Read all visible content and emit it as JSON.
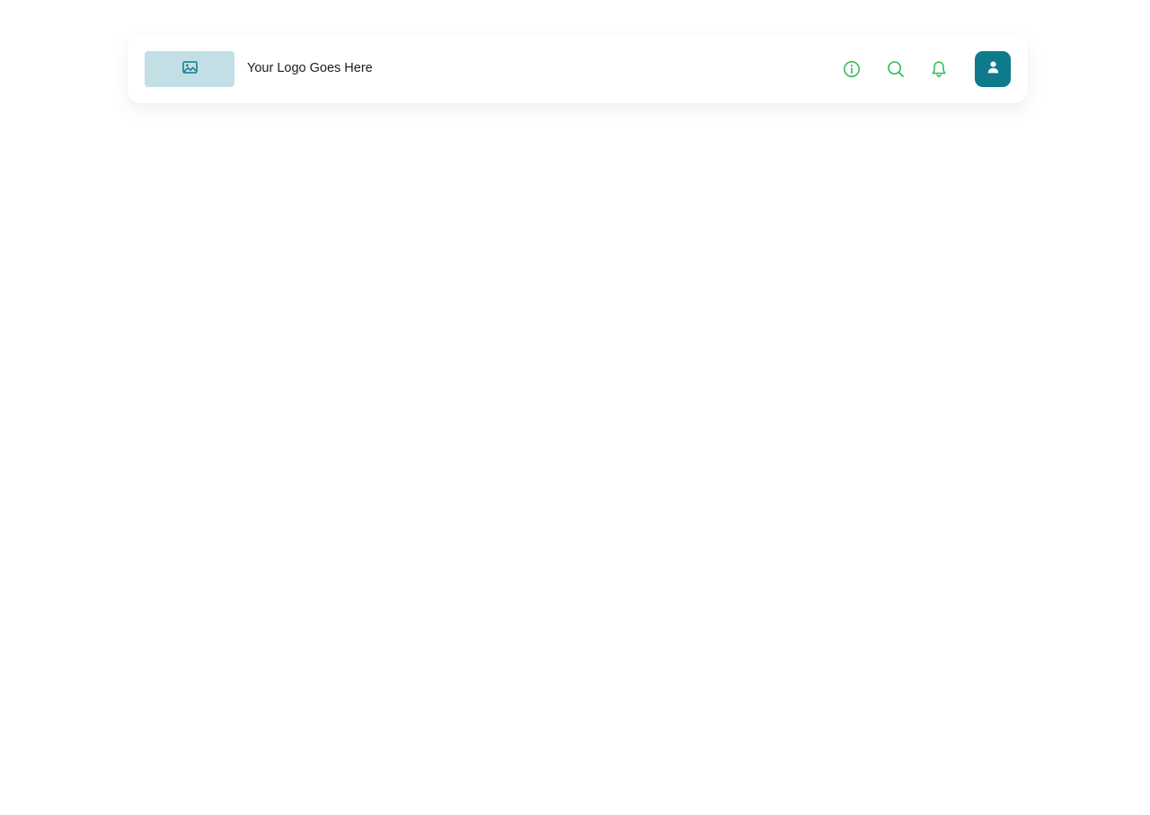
{
  "header": {
    "logo_text": "Your Logo Goes Here"
  },
  "icons": {
    "logo": "image-icon",
    "info": "info-icon",
    "search": "search-icon",
    "notifications": "bell-icon",
    "avatar": "user-icon"
  },
  "colors": {
    "logo_placeholder_bg": "#c3dfe6",
    "logo_icon": "#0e7a8c",
    "action_icon": "#2dbb4e",
    "avatar_bg": "#0e7a8c",
    "avatar_icon": "#ffffff"
  }
}
